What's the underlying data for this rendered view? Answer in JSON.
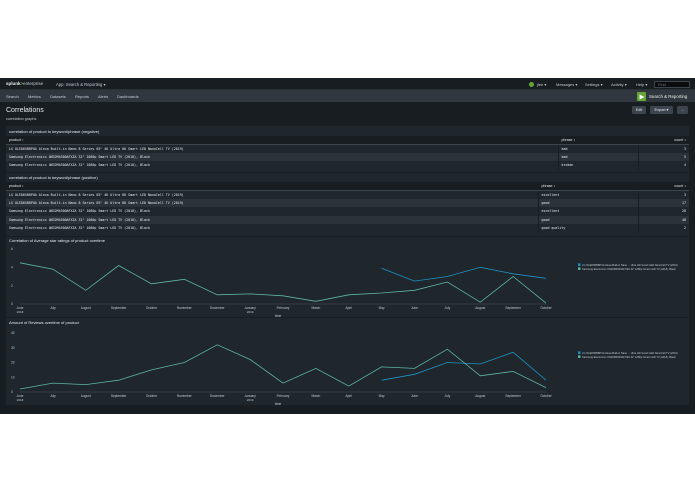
{
  "topbar": {
    "logo_main": "splunk",
    "logo_gt": ">",
    "logo_suffix": "enterprise",
    "app_menu": "App: Search & Reporting ▾",
    "user": "jlee ▾",
    "messages": "Messages ▾",
    "settings": "Settings ▾",
    "activity": "Activity ▾",
    "help": "Help ▾",
    "find_placeholder": "Find"
  },
  "nav": {
    "items": [
      "Search",
      "Metrics",
      "Datasets",
      "Reports",
      "Alerts",
      "Dashboards"
    ],
    "app_name": "Search & Reporting"
  },
  "header": {
    "title": "Correlations",
    "description": "correlation graphs",
    "edit_label": "Edit",
    "export_label": "Export ▾",
    "more_label": "..."
  },
  "panel_negative": {
    "title": "correlation of product to keyword/phrase (negative)",
    "columns": [
      "product ↕",
      "phrase ↕",
      "count ↕"
    ],
    "rows": [
      [
        "LG OLED65B8PUA Alexa Built-in Nano 8 Series 65\" 4K Ultra HD Smart LED NanoCell TV (2019)",
        "bad",
        "3"
      ],
      [
        "Samsung Electronics UN32M4500AFXZA 32\" 1080p Smart LED TV (2018), Black",
        "bad",
        "5"
      ],
      [
        "Samsung Electronics UN32M4500AFXZA 32\" 1080p Smart LED TV (2018), Black",
        "broken",
        "4"
      ]
    ]
  },
  "panel_positive": {
    "title": "correlation of product to keyword/phrase (positive)",
    "columns": [
      "product ↕",
      "phrase ↕",
      "count ↕"
    ],
    "rows": [
      [
        "LG OLED65B8PUA Alexa Built-in Nano 8 Series 65\" 4K Ultra HD Smart LED NanoCell TV (2019)",
        "excellent",
        "3"
      ],
      [
        "LG OLED65B8PUA Alexa Built-in Nano 8 Series 65\" 4K Ultra HD Smart LED NanoCell TV (2019)",
        "good",
        "17"
      ],
      [
        "Samsung Electronics UN32M4500AFXZA 32\" 1080p Smart LED TV (2018), Black",
        "excellent",
        "28"
      ],
      [
        "Samsung Electronics UN32M4500AFXZA 32\" 1080p Smart LED TV (2018), Black",
        "good",
        "48"
      ],
      [
        "Samsung Electronics UN32M4500AFXZA 32\" 1080p Smart LED TV (2018), Black",
        "good quality",
        "2"
      ]
    ]
  },
  "chart_data": [
    {
      "type": "line",
      "title": "Correlation of Average star ratings of product overtime",
      "xlabel": "_time",
      "ylabel": "",
      "ylim": [
        0,
        6
      ],
      "yticks": [
        "0",
        "2",
        "4",
        "6"
      ],
      "x": [
        "June 2018",
        "July",
        "August",
        "September",
        "October",
        "November",
        "December",
        "January 2019",
        "February",
        "March",
        "April",
        "May",
        "June",
        "July",
        "August",
        "September",
        "October"
      ],
      "x_tick_labels": [
        "June",
        "July",
        "August",
        "September",
        "October",
        "November",
        "December",
        "January",
        "February",
        "March",
        "April",
        "May",
        "June",
        "July",
        "August",
        "September",
        "October"
      ],
      "x_tick_sublabels": {
        "0": "2018",
        "7": "2019"
      },
      "legend_placement": "right",
      "series": [
        {
          "name": "LG OLED65B8PUA Alexa Built-in Nano ... Ultra HD Smart LED NanoCell TV (2019)",
          "color": "#1e93c6",
          "values": [
            null,
            null,
            null,
            null,
            null,
            null,
            null,
            null,
            null,
            null,
            null,
            3.9,
            2.5,
            3.0,
            4.0,
            3.3,
            2.8
          ]
        },
        {
          "name": "Samsung Electronics UN32M4500AFXZA 32\" 1080p Smart LED TV (2018), Black",
          "color": "#5fb6a4",
          "values": [
            4.5,
            3.8,
            1.5,
            4.2,
            2.2,
            2.7,
            1.0,
            1.1,
            0.9,
            0.3,
            1.0,
            1.2,
            1.5,
            2.4,
            0.2,
            3.0,
            0.1
          ]
        }
      ]
    },
    {
      "type": "line",
      "title": "Amount of Reviews overtime of product",
      "xlabel": "_time",
      "ylabel": "",
      "ylim": [
        0,
        40
      ],
      "yticks": [
        "0",
        "10",
        "20",
        "30",
        "40"
      ],
      "x": [
        "June 2018",
        "July",
        "August",
        "September",
        "October",
        "November",
        "December",
        "January 2019",
        "February",
        "March",
        "April",
        "May",
        "June",
        "July",
        "August",
        "September",
        "October"
      ],
      "x_tick_labels": [
        "June",
        "July",
        "August",
        "September",
        "October",
        "November",
        "December",
        "January",
        "February",
        "March",
        "April",
        "May",
        "June",
        "July",
        "August",
        "September",
        "October"
      ],
      "x_tick_sublabels": {
        "0": "2018",
        "7": "2019"
      },
      "legend_placement": "right",
      "series": [
        {
          "name": "LG OLED65B8PUA Alexa Built-in Nano ... Ultra HD Smart LED NanoCell TV (2019)",
          "color": "#1e93c6",
          "values": [
            null,
            null,
            null,
            null,
            null,
            null,
            null,
            null,
            null,
            null,
            null,
            8,
            12,
            20,
            19,
            27,
            8
          ]
        },
        {
          "name": "Samsung Electronics UN32M4500AFXZA 32\" 1080p Smart LED TV (2018), Black",
          "color": "#5fb6a4",
          "values": [
            2,
            6,
            5,
            8,
            15,
            20,
            32,
            22,
            6,
            16,
            4,
            17,
            16,
            29,
            11,
            14,
            3
          ]
        }
      ]
    }
  ]
}
